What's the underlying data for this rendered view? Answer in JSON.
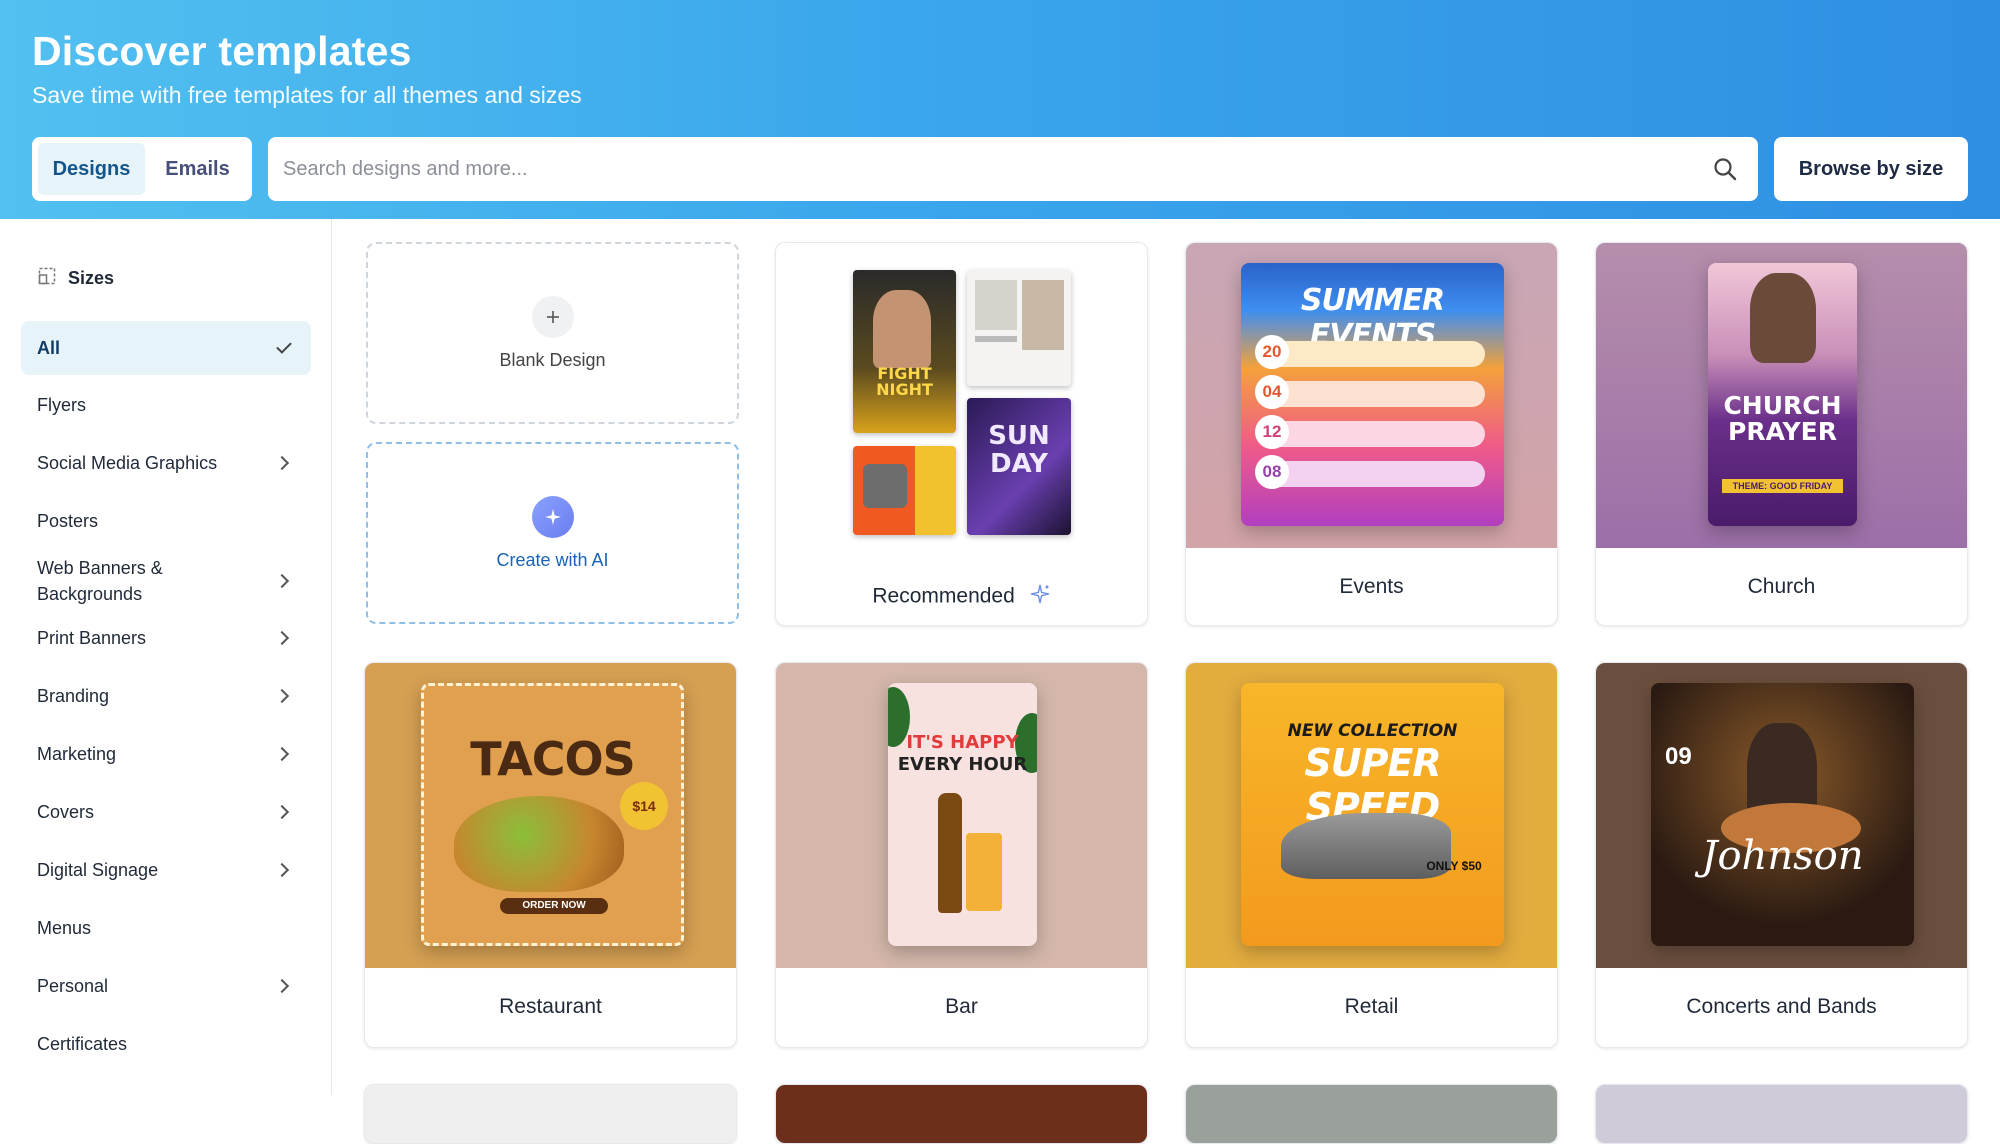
{
  "header": {
    "title": "Discover templates",
    "subtitle": "Save time with free templates for all themes and sizes",
    "tabs": [
      {
        "label": "Designs",
        "active": true
      },
      {
        "label": "Emails",
        "active": false
      }
    ],
    "search_placeholder": "Search designs and more...",
    "browse_label": "Browse by size"
  },
  "sidebar": {
    "title": "Sizes",
    "items": [
      {
        "label": "All",
        "active": true
      },
      {
        "label": "Flyers"
      },
      {
        "label": "Social Media Graphics",
        "chevron": true
      },
      {
        "label": "Posters"
      },
      {
        "label": "Web Banners & Backgrounds",
        "chevron": true
      },
      {
        "label": "Print Banners",
        "chevron": true
      },
      {
        "label": "Branding",
        "chevron": true
      },
      {
        "label": "Marketing",
        "chevron": true
      },
      {
        "label": "Covers",
        "chevron": true
      },
      {
        "label": "Digital Signage",
        "chevron": true
      },
      {
        "label": "Menus"
      },
      {
        "label": "Personal",
        "chevron": true
      },
      {
        "label": "Certificates"
      }
    ]
  },
  "actions": {
    "blank_label": "Blank Design",
    "ai_label": "Create with AI"
  },
  "cards": [
    {
      "label": "Recommended"
    },
    {
      "label": "Events"
    },
    {
      "label": "Church"
    },
    {
      "label": "Restaurant"
    },
    {
      "label": "Bar"
    },
    {
      "label": "Retail"
    },
    {
      "label": "Concerts and Bands"
    }
  ],
  "posters": {
    "events": {
      "title": "SUMMER EVENTS",
      "dates": [
        "20",
        "04",
        "12",
        "08"
      ]
    },
    "church": {
      "title1": "CHURCH",
      "title2": "PRAYER",
      "theme": "THEME: GOOD FRIDAY"
    },
    "restaurant": {
      "title": "TACOS",
      "price": "$14",
      "footer": "ORDER NOW"
    },
    "bar": {
      "line1": "IT'S HAPPY",
      "line2": "EVERY HOUR"
    },
    "retail": {
      "line1": "NEW COLLECTION",
      "line2": "SUPER SPEED",
      "price": "ONLY $50"
    },
    "concert": {
      "title": "Johnson",
      "date": "09"
    },
    "recommended": {
      "fight": "FIGHT NIGHT",
      "sunday": "SUN DAY"
    }
  },
  "colors": {
    "accent": "#2f8fe3",
    "active_bg": "#e6f4fa",
    "ai_link": "#1a63b8"
  }
}
